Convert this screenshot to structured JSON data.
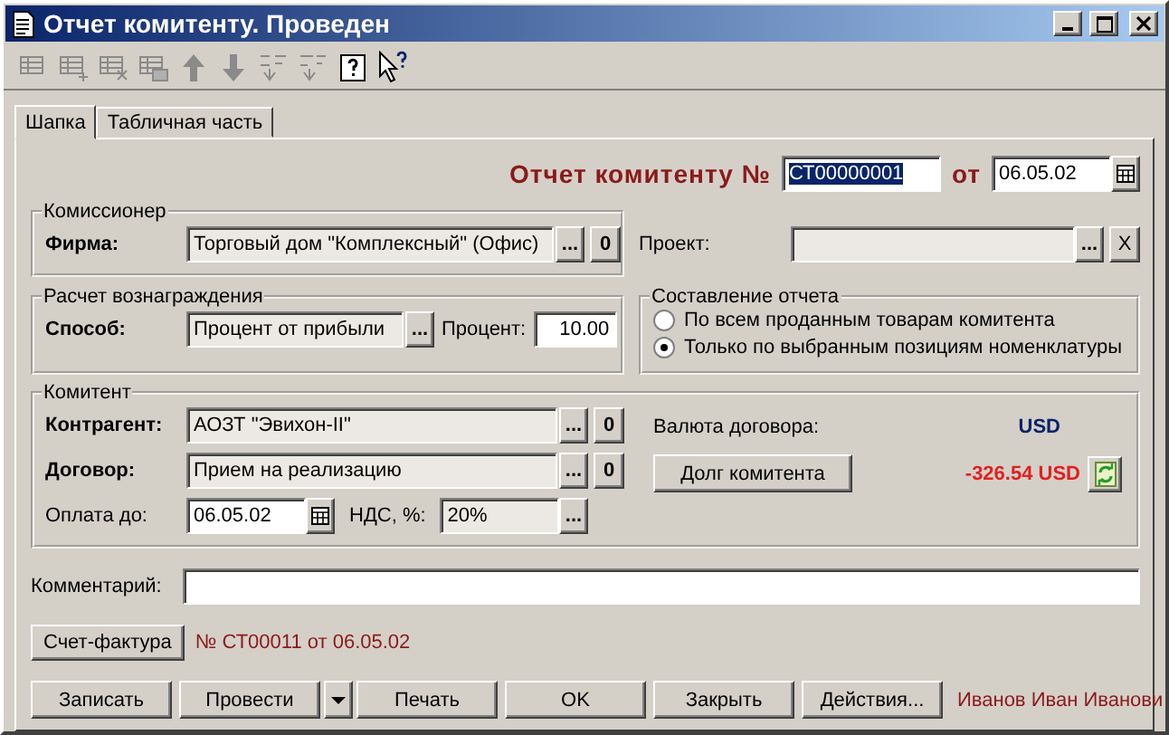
{
  "window": {
    "title": "Отчет комитенту. Проведен"
  },
  "toolbar": [
    {
      "kind": "table",
      "disabled": true
    },
    {
      "kind": "table-add",
      "disabled": true
    },
    {
      "kind": "table-delete",
      "disabled": true
    },
    {
      "kind": "table-copy",
      "disabled": true
    },
    {
      "kind": "up",
      "disabled": true
    },
    {
      "kind": "down",
      "disabled": true
    },
    {
      "kind": "sort-asc",
      "disabled": true
    },
    {
      "kind": "sort-desc",
      "disabled": true
    },
    {
      "kind": "help",
      "disabled": false
    },
    {
      "kind": "pointer-help",
      "disabled": false
    }
  ],
  "tabs": [
    {
      "label": "Шапка",
      "selected": true
    },
    {
      "label": "Табличная часть",
      "selected": false
    }
  ],
  "header": {
    "title": "Отчет комитенту №",
    "number": "СТ00000001",
    "selected": true,
    "date_label": "от",
    "date": "06.05.02"
  },
  "commissioner": {
    "legend": "Комиссионер",
    "label": "Фирма:",
    "value": "Торговый дом \"Комплексный\" (Офис)",
    "pick": "...",
    "clear": "0"
  },
  "project": {
    "label": "Проект:",
    "pick": "...",
    "clear": "X"
  },
  "reward": {
    "legend": "Расчет вознаграждения",
    "label": "Способ:",
    "value": "Процент от прибыли",
    "pick": "...",
    "percent_label": "Процент:",
    "percent": "10.00"
  },
  "report_scope": {
    "legend": "Составление отчета",
    "options": [
      {
        "label": "По всем проданным товарам комитента",
        "selected": false
      },
      {
        "label": "Только по выбранным позициям номенклатуры",
        "selected": true
      }
    ]
  },
  "consignor": {
    "legend": "Комитент",
    "rows": [
      {
        "label": "Контрагент:",
        "value": "АОЗТ \"Эвихон-II\"",
        "pick": "...",
        "clear": "0"
      },
      {
        "label": "Договор:",
        "value": "Прием на реализацию",
        "pick": "...",
        "clear": "0"
      }
    ],
    "pay_until_label": "Оплата до:",
    "pay_until": "06.05.02",
    "vat_label": "НДС, %:",
    "vat": "20%",
    "vat_pick": "...",
    "currency_label": "Валюта договора:",
    "currency": "USD",
    "debt_button": "Долг комитента",
    "debt": "-326.54 USD"
  },
  "comment": {
    "label": "Комментарий:"
  },
  "invoice": {
    "button": "Счет-фактура",
    "text": "№ СТ00011 от 06.05.02"
  },
  "buttons": [
    {
      "kind": "button",
      "label": "Записать"
    },
    {
      "kind": "button",
      "label": "Провести"
    },
    {
      "kind": "menu"
    },
    {
      "kind": "button",
      "label": "Печать"
    },
    {
      "kind": "button",
      "label": "OK"
    },
    {
      "kind": "button",
      "label": "Закрыть"
    },
    {
      "kind": "button",
      "label": "Действия..."
    }
  ],
  "user": "Иванов Иван Иванови"
}
